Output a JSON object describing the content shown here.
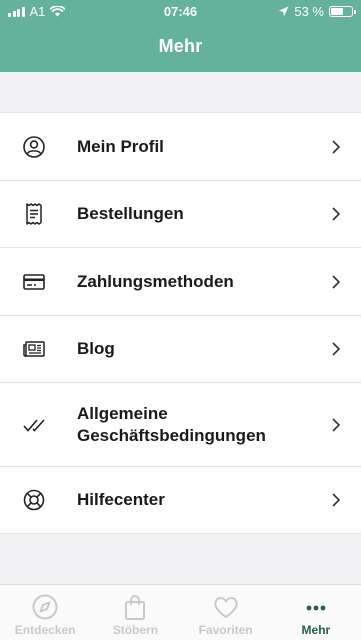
{
  "status_bar": {
    "carrier": "A1",
    "time": "07:46",
    "battery_percent": "53 %",
    "battery_level": 0.53
  },
  "header": {
    "title": "Mehr"
  },
  "menu": {
    "items": [
      {
        "label": "Mein Profil",
        "icon": "profile-icon"
      },
      {
        "label": "Bestellungen",
        "icon": "receipt-icon"
      },
      {
        "label": "Zahlungsmethoden",
        "icon": "credit-card-icon"
      },
      {
        "label": "Blog",
        "icon": "newspaper-icon"
      },
      {
        "label": "Allgemeine Geschäftsbedingungen",
        "icon": "checkmark-icon"
      },
      {
        "label": "Hilfecenter",
        "icon": "lifebuoy-icon"
      }
    ]
  },
  "tabbar": {
    "tabs": [
      {
        "label": "Entdecken",
        "icon": "compass-icon",
        "active": false
      },
      {
        "label": "Stöbern",
        "icon": "shopping-bag-icon",
        "active": false
      },
      {
        "label": "Favoriten",
        "icon": "heart-icon",
        "active": false
      },
      {
        "label": "Mehr",
        "icon": "more-dots-icon",
        "active": true
      }
    ]
  },
  "colors": {
    "header_bg": "#65b29c",
    "active_tab": "#2a5a50",
    "inactive_tab": "#c9c9cc"
  }
}
